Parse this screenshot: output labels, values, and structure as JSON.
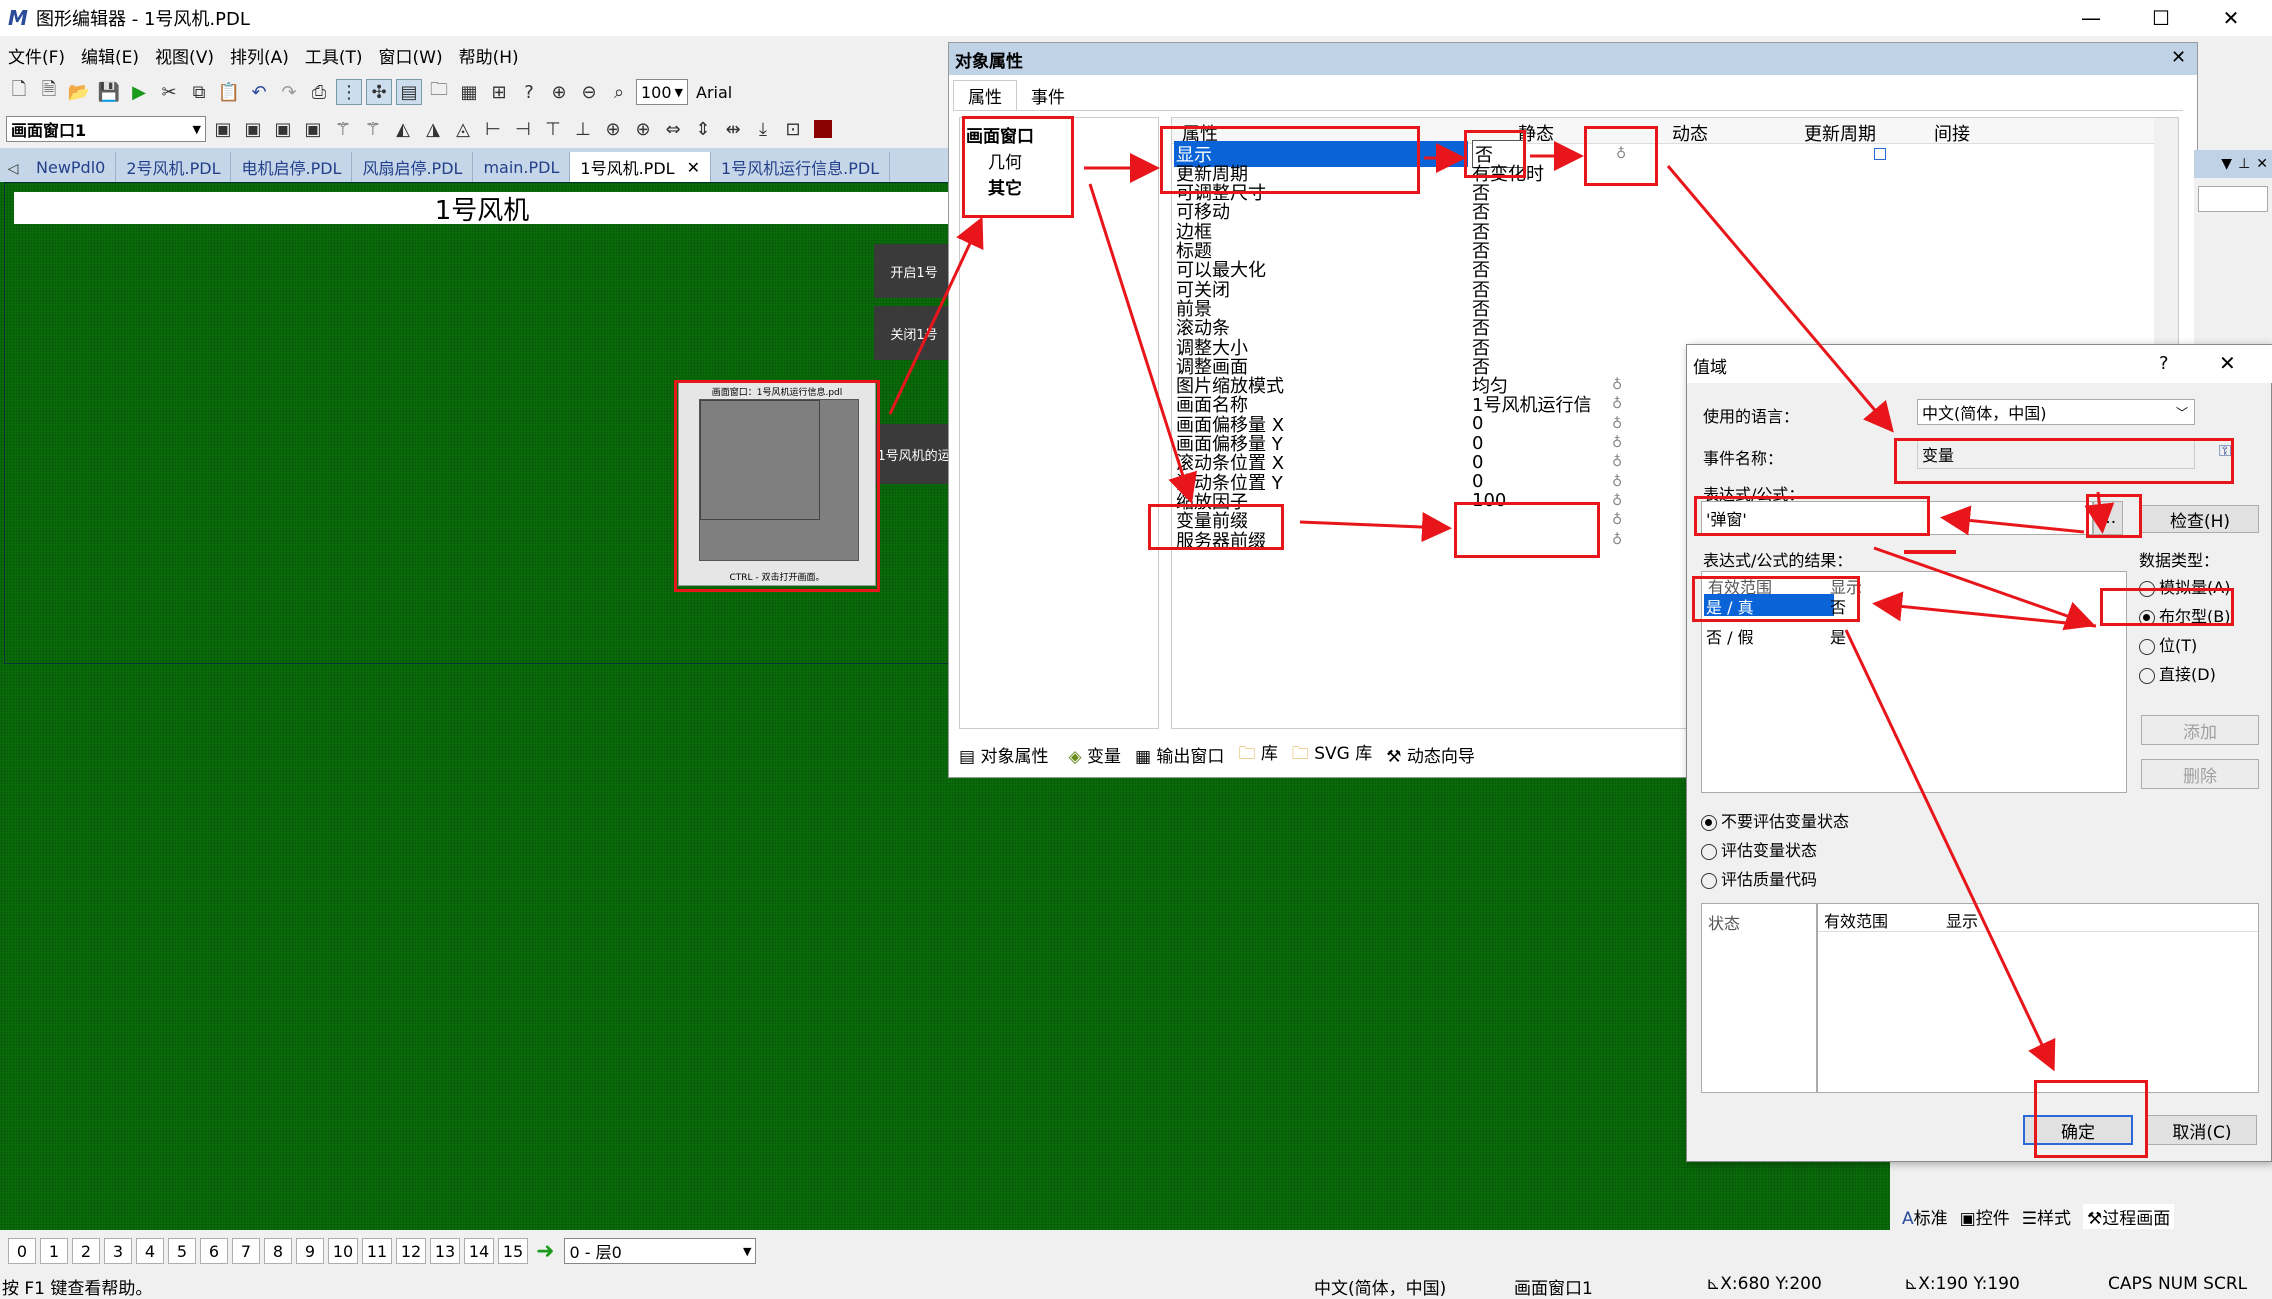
{
  "window": {
    "title": "图形编辑器 - 1号风机.PDL",
    "minimize": "—",
    "maximize": "☐",
    "close": "✕"
  },
  "menu": [
    "文件(F)",
    "编辑(E)",
    "视图(V)",
    "排列(A)",
    "工具(T)",
    "窗口(W)",
    "帮助(H)"
  ],
  "toolbar": {
    "zoom_value": "100",
    "font_name": "Arial",
    "object_select": "画面窗口1"
  },
  "tabs": [
    {
      "label": "NewPdl0"
    },
    {
      "label": "2号风机.PDL"
    },
    {
      "label": "电机启停.PDL"
    },
    {
      "label": "风扇启停.PDL"
    },
    {
      "label": "main.PDL"
    },
    {
      "label": "1号风机.PDL",
      "active": true
    },
    {
      "label": "1号风机运行信息.PDL"
    }
  ],
  "canvas": {
    "title": "1号风机",
    "buttons": [
      "开启1号",
      "关闭1号",
      "1号风机的运"
    ],
    "picture_window": {
      "top_text": "画面窗口：1号风机运行信息.pdl",
      "bottom_text": "CTRL - 双击打开画面。"
    }
  },
  "props_panel": {
    "title": "对象属性",
    "close": "✕",
    "tabs": [
      "属性",
      "事件"
    ],
    "tree": {
      "root": "画面窗口",
      "children": [
        "几何",
        "其它"
      ]
    },
    "columns": {
      "name": "属性",
      "static": "静态",
      "dynamic": "动态",
      "update": "更新周期",
      "indirect": "间接"
    },
    "rows": [
      {
        "name": "显示",
        "value": "否",
        "selected": true
      },
      {
        "name": "更新周期",
        "value": "有变化时"
      },
      {
        "name": "可调整尺寸",
        "value": "否"
      },
      {
        "name": "可移动",
        "value": "否"
      },
      {
        "name": "边框",
        "value": "否"
      },
      {
        "name": "标题",
        "value": "否"
      },
      {
        "name": "可以最大化",
        "value": "否"
      },
      {
        "name": "可关闭",
        "value": "否"
      },
      {
        "name": "前景",
        "value": "否"
      },
      {
        "name": "滚动条",
        "value": "否"
      },
      {
        "name": "调整大小",
        "value": "否"
      },
      {
        "name": "调整画面",
        "value": "否"
      },
      {
        "name": "图片缩放模式",
        "value": "均匀"
      },
      {
        "name": "画面名称",
        "value": "1号风机运行信"
      },
      {
        "name": "画面偏移量 X",
        "value": "0"
      },
      {
        "name": "画面偏移量 Y",
        "value": "0"
      },
      {
        "name": "滚动条位置 X",
        "value": "0"
      },
      {
        "name": "滚动条位置 Y",
        "value": "0"
      },
      {
        "name": "缩放因子",
        "value": "100"
      },
      {
        "name": "变量前缀",
        "value": ""
      },
      {
        "name": "服务器前缀",
        "value": ""
      }
    ],
    "bottom_tabs": [
      "对象属性",
      "变量",
      "输出窗口",
      "库",
      "SVG 库",
      "动态向导"
    ]
  },
  "dialog": {
    "title": "值域",
    "help": "?",
    "close": "✕",
    "language_label": "使用的语言：",
    "language_value": "中文(简体，中国)",
    "event_label": "事件名称：",
    "event_value": "变量",
    "expr_label": "表达式/公式：",
    "expr_value": "'弹窗'",
    "browse": "...",
    "check_button": "检查(H)",
    "result_label": "表达式/公式的结果：",
    "result_cols": [
      "有效范围",
      "显示"
    ],
    "result_rows": [
      {
        "range": "是 / 真",
        "value": "否",
        "selected": true
      },
      {
        "range": "否 / 假",
        "value": "是"
      }
    ],
    "datatype_label": "数据类型：",
    "datatypes": [
      {
        "label": "模拟量(A)",
        "checked": false
      },
      {
        "label": "布尔型(B)",
        "checked": true
      },
      {
        "label": "位(T)",
        "checked": false
      },
      {
        "label": "直接(D)",
        "checked": false
      }
    ],
    "add_button": "添加",
    "delete_button": "删除",
    "eval_options": [
      {
        "label": "不要评估变量状态",
        "checked": true
      },
      {
        "label": "评估变量状态",
        "checked": false
      },
      {
        "label": "评估质量代码",
        "checked": false
      }
    ],
    "state_label": "状态",
    "state_cols": [
      "有效范围",
      "显示"
    ],
    "ok_button": "确定",
    "cancel_button": "取消(C)"
  },
  "right_panel": {
    "tabs": [
      "标准",
      "控件",
      "样式",
      "过程画面"
    ]
  },
  "layers": {
    "numbers": [
      "0",
      "1",
      "2",
      "3",
      "4",
      "5",
      "6",
      "7",
      "8",
      "9",
      "10",
      "11",
      "12",
      "13",
      "14",
      "15"
    ],
    "layer_select": "0 - 层0"
  },
  "status": {
    "help": "按 F1 键查看帮助。",
    "language": "中文(简体，中国)",
    "object": "画面窗口1",
    "position": "X:680 Y:200",
    "size": "X:190 Y:190",
    "keys": "CAPS NUM SCRL"
  },
  "colors": {
    "canvas": "#0a6b0a",
    "highlight": "#e8161b",
    "selection": "#0a64d8"
  }
}
